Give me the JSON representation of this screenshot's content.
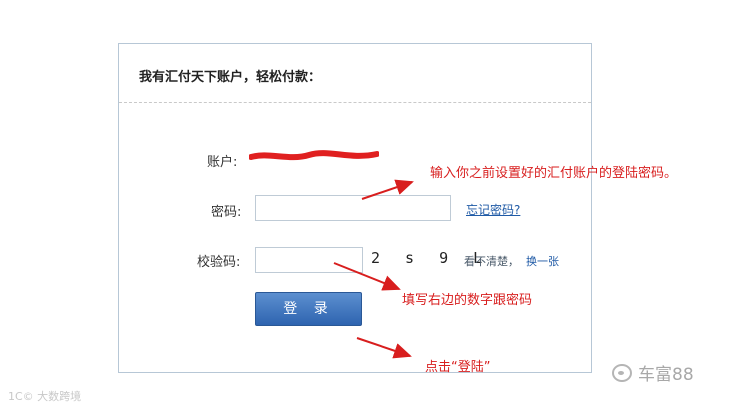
{
  "panel": {
    "title": "我有汇付天下账户，轻松付款："
  },
  "form": {
    "account_label": "账户:",
    "password_label": "密码:",
    "forgot_password_link": "忘记密码?",
    "captcha_label": "校验码:",
    "captcha_value": "2 s 9 L",
    "cant_see_text": "看不清楚，",
    "refresh_link": "换一张",
    "login_button": "登 录"
  },
  "annotations": {
    "password_hint": "输入你之前设置好的汇付账户的登陆密码。",
    "captcha_hint": "填写右边的数字跟密码",
    "login_hint": "点击“登陆”"
  },
  "watermarks": {
    "left": "1C© 大数跨境",
    "right": "车富88"
  },
  "colors": {
    "annotation": "#d81e1e",
    "link": "#1f5aa6",
    "button": "#3f74bf"
  }
}
